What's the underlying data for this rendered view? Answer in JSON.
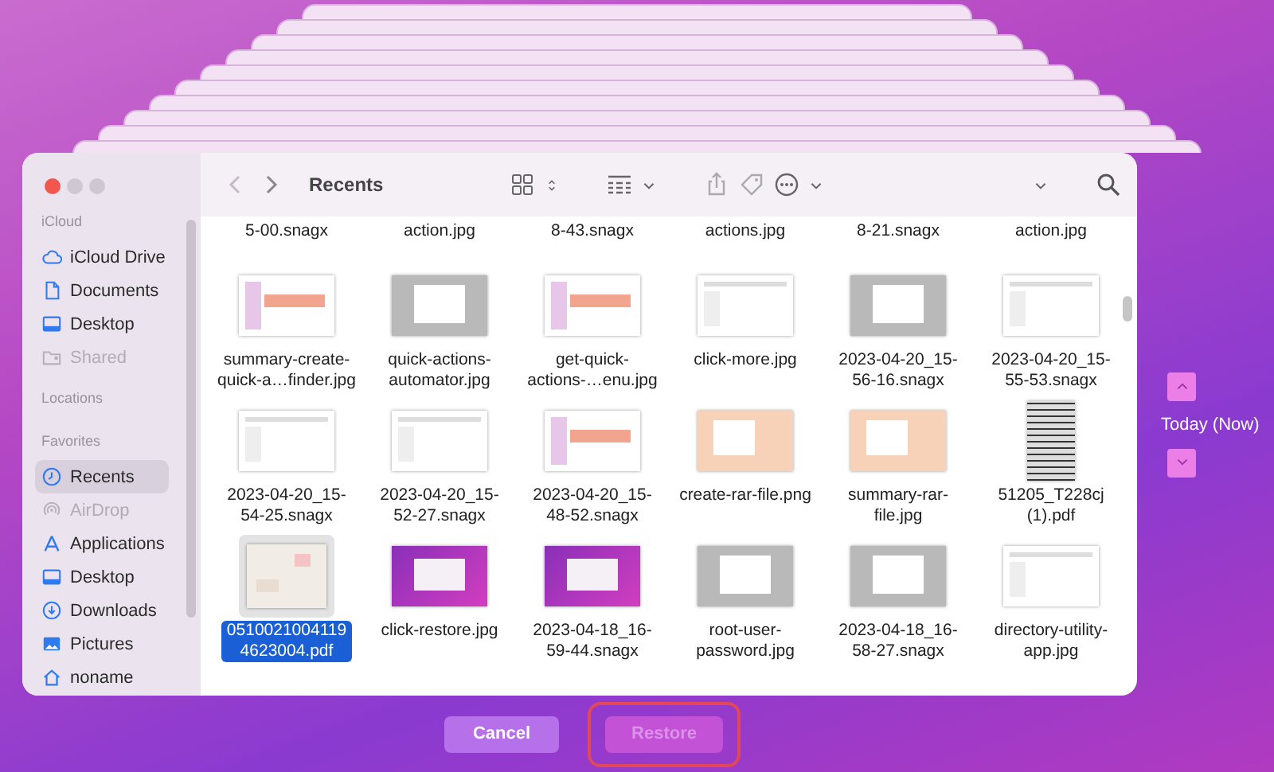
{
  "window": {
    "title": "Recents"
  },
  "sidebar": {
    "sections": [
      {
        "heading": "iCloud",
        "items": [
          {
            "label": "iCloud Drive",
            "kind": "cloud",
            "selected": false,
            "disabled": false
          },
          {
            "label": "Documents",
            "kind": "document",
            "selected": false,
            "disabled": false
          },
          {
            "label": "Desktop",
            "kind": "desktop",
            "selected": false,
            "disabled": false
          },
          {
            "label": "Shared",
            "kind": "shared",
            "selected": false,
            "disabled": true
          }
        ]
      },
      {
        "heading": "Locations"
      },
      {
        "heading": "Favorites",
        "items": [
          {
            "label": "Recents",
            "kind": "clock",
            "selected": true,
            "disabled": false
          },
          {
            "label": "AirDrop",
            "kind": "airdrop",
            "selected": false,
            "disabled": true
          },
          {
            "label": "Applications",
            "kind": "apps",
            "selected": false,
            "disabled": false
          },
          {
            "label": "Desktop",
            "kind": "desktop",
            "selected": false,
            "disabled": false
          },
          {
            "label": "Downloads",
            "kind": "download",
            "selected": false,
            "disabled": false
          },
          {
            "label": "Pictures",
            "kind": "pictures",
            "selected": false,
            "disabled": false
          },
          {
            "label": "noname",
            "kind": "home",
            "selected": false,
            "disabled": false
          }
        ]
      }
    ]
  },
  "files": {
    "partial_row": [
      "5-00.snagx",
      "action.jpg",
      "8-43.snagx",
      "actions.jpg",
      "8-21.snagx",
      "action.jpg"
    ],
    "rows": [
      [
        {
          "name": "summary-create-quick-a…finder.jpg",
          "kind": "pink",
          "selected": false
        },
        {
          "name": "quick-actions-automator.jpg",
          "kind": "gray",
          "selected": false
        },
        {
          "name": "get-quick-actions-…enu.jpg",
          "kind": "pink",
          "selected": false
        },
        {
          "name": "click-more.jpg",
          "kind": "white",
          "selected": false
        },
        {
          "name": "2023-04-20_15-56-16.snagx",
          "kind": "gray",
          "selected": false
        },
        {
          "name": "2023-04-20_15-55-53.snagx",
          "kind": "white",
          "selected": false
        }
      ],
      [
        {
          "name": "2023-04-20_15-54-25.snagx",
          "kind": "white",
          "selected": false
        },
        {
          "name": "2023-04-20_15-52-27.snagx",
          "kind": "white",
          "selected": false
        },
        {
          "name": "2023-04-20_15-48-52.snagx",
          "kind": "pink",
          "selected": false
        },
        {
          "name": "create-rar-file.png",
          "kind": "peach",
          "selected": false
        },
        {
          "name": "summary-rar-file.jpg",
          "kind": "peach",
          "selected": false
        },
        {
          "name": "51205_T228cj (1).pdf",
          "kind": "grid",
          "selected": false
        }
      ],
      [
        {
          "name": "05100210041194623004.pdf",
          "kind": "pdf",
          "selected": true
        },
        {
          "name": "click-restore.jpg",
          "kind": "purple",
          "selected": false
        },
        {
          "name": "2023-04-18_16-59-44.snagx",
          "kind": "purple",
          "selected": false
        },
        {
          "name": "root-user-password.jpg",
          "kind": "gray",
          "selected": false
        },
        {
          "name": "2023-04-18_16-58-27.snagx",
          "kind": "gray",
          "selected": false
        },
        {
          "name": "directory-utility-app.jpg",
          "kind": "white",
          "selected": false
        }
      ]
    ]
  },
  "timeline": {
    "label": "Today (Now)"
  },
  "buttons": [
    {
      "label": "Cancel",
      "disabled": false,
      "highlighted": false
    },
    {
      "label": "Restore",
      "disabled": true,
      "highlighted": true
    }
  ]
}
